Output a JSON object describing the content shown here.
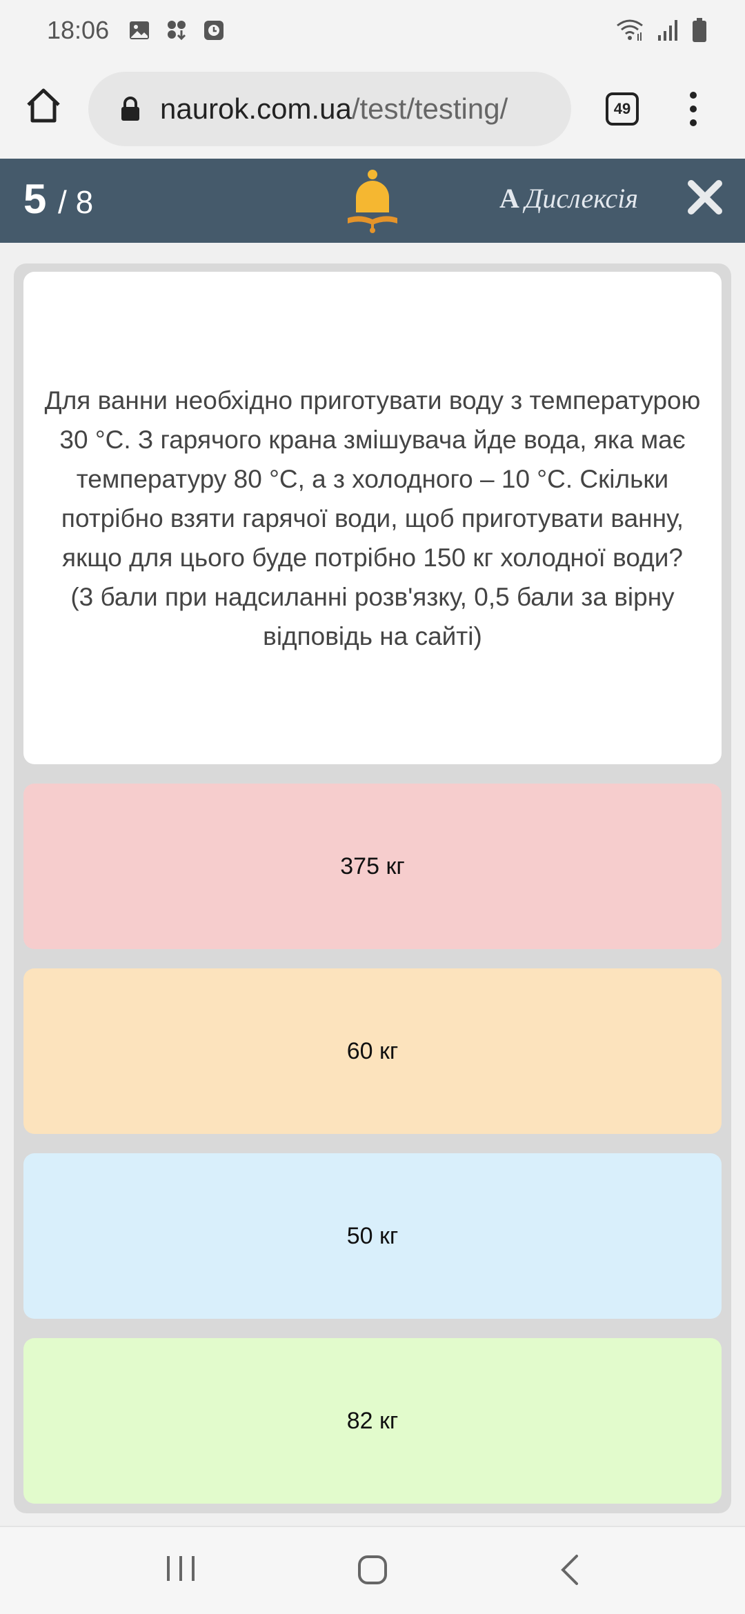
{
  "status_bar": {
    "time": "18:06"
  },
  "browser": {
    "url_domain": "naurok.com.ua",
    "url_path": "/test/testing/",
    "tab_count": "49"
  },
  "quiz": {
    "current": "5",
    "separator_total": "/ 8",
    "dyslexia_glyph": "A",
    "dyslexia_label": "Дислексія",
    "accent_color": "#455a6b",
    "bell_color": "#f5b731"
  },
  "question": {
    "text": "Для ванни необхідно приготувати воду з температурою 30 °С. З гарячого крана змішувача йде вода, яка має температуру 80 °С, а з холодного – 10 °С. Скільки потрібно взяти гарячої води, щоб приготувати ванну, якщо для цього буде потрібно 150 кг холодної води?",
    "note": "(3 бали при надсиланні розв'язку, 0,5 бали за вірну відповідь на сайті)"
  },
  "answers": [
    {
      "label": "375 кг",
      "color": "#f6cdcd"
    },
    {
      "label": "60 кг",
      "color": "#fce3bd"
    },
    {
      "label": "50 кг",
      "color": "#d9effb"
    },
    {
      "label": "82 кг",
      "color": "#e2fbcc"
    }
  ]
}
